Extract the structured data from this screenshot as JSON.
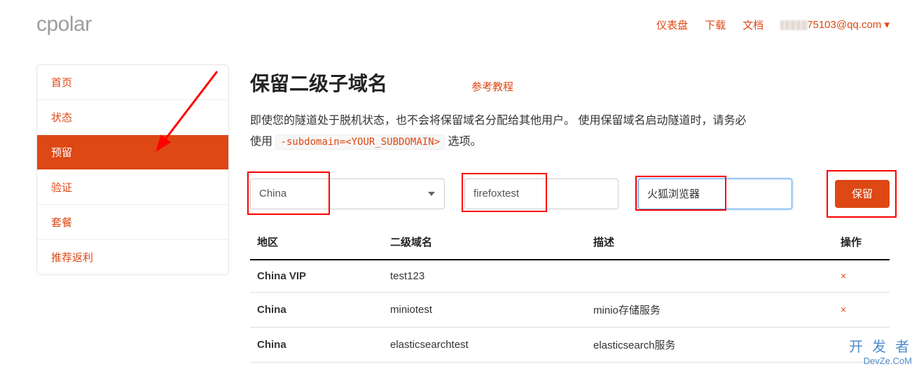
{
  "brand": "cpolar",
  "topnav": {
    "dashboard": "仪表盘",
    "download": "下载",
    "docs": "文档",
    "email_visible": "75103@qq.com"
  },
  "sidebar": {
    "items": [
      {
        "label": "首页"
      },
      {
        "label": "状态"
      },
      {
        "label": "预留"
      },
      {
        "label": "验证"
      },
      {
        "label": "套餐"
      },
      {
        "label": "推荐返利"
      }
    ],
    "active_index": 2
  },
  "page": {
    "title": "保留二级子域名",
    "ref_link": "参考教程",
    "desc_prefix": "即使您的隧道处于脱机状态，也不会将保留域名分配给其他用户。 使用保留域名启动隧道时，请务必使用 ",
    "desc_code": "-subdomain=<YOUR_SUBDOMAIN>",
    "desc_suffix": " 选项。"
  },
  "form": {
    "region_selected": "China",
    "subdomain_value": "firefoxtest",
    "description_value": "火狐浏览器",
    "reserve_btn": "保留"
  },
  "table": {
    "headers": {
      "region": "地区",
      "subdomain": "二级域名",
      "desc": "描述",
      "action": "操作"
    },
    "rows": [
      {
        "region": "China VIP",
        "subdomain": "test123",
        "desc": "",
        "deletable": true
      },
      {
        "region": "China",
        "subdomain": "miniotest",
        "desc": "minio存储服务",
        "deletable": true
      },
      {
        "region": "China",
        "subdomain": "elasticsearchtest",
        "desc": "elasticsearch服务",
        "deletable": false
      }
    ]
  },
  "watermark": {
    "line1": "开 发 者",
    "line2": "DevZe.CoM"
  },
  "icons": {
    "delete": "×",
    "dropdown": "▾"
  }
}
